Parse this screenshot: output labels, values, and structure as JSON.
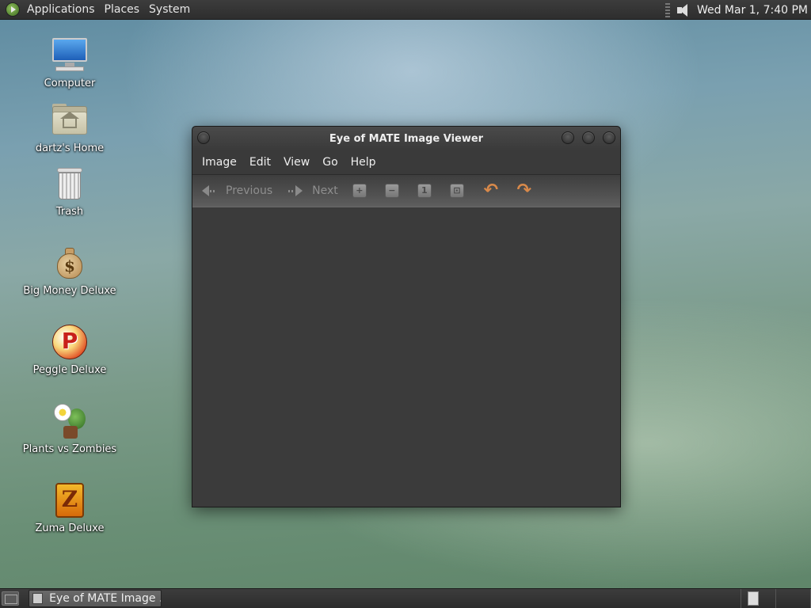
{
  "top_panel": {
    "menus": [
      "Applications",
      "Places",
      "System"
    ],
    "clock": "Wed Mar  1,  7:40 PM"
  },
  "desktop_icons": [
    {
      "label": "Computer",
      "icon": "computer-icon"
    },
    {
      "label": "dartz's Home",
      "icon": "home-folder-icon"
    },
    {
      "label": "Trash",
      "icon": "trash-icon"
    },
    {
      "label": "Big Money Deluxe",
      "icon": "money-bag-icon"
    },
    {
      "label": "Peggle Deluxe",
      "icon": "peggle-icon"
    },
    {
      "label": "Plants vs Zombies",
      "icon": "plants-vs-zombies-icon"
    },
    {
      "label": "Zuma Deluxe",
      "icon": "zuma-icon"
    }
  ],
  "window": {
    "title": "Eye of MATE Image Viewer",
    "menus": [
      "Image",
      "Edit",
      "View",
      "Go",
      "Help"
    ],
    "toolbar": {
      "previous_label": "Previous",
      "next_label": "Next",
      "zoom_in_icon": "zoom-in-icon",
      "zoom_out_icon": "zoom-out-icon",
      "normal_size_icon": "normal-size-icon",
      "best_fit_icon": "best-fit-icon",
      "rotate_left_icon": "rotate-left-icon",
      "rotate_right_icon": "rotate-right-icon"
    }
  },
  "bottom_panel": {
    "task_label": "Eye of MATE Image ..."
  },
  "colors": {
    "panel": "#333333",
    "window_bg": "#3a3a3a",
    "rotate_icon": "#d8894a"
  }
}
